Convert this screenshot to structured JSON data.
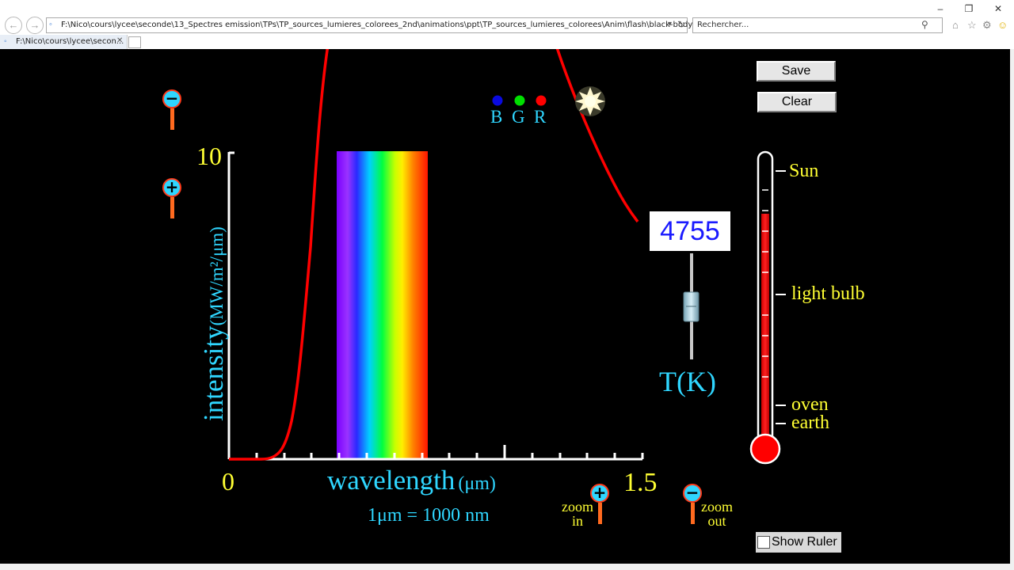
{
  "browser": {
    "address": "F:\\Nico\\cours\\lycee\\seconde\\13_Spectres emission\\TPs\\TP_sources_lumieres_colorees_2nd\\animations\\ppt\\TP_sources_lumieres_colorees\\Anim\\flash\\black-body-radiation.swf",
    "search_placeholder": "Rechercher...",
    "tab_title": "F:\\Nico\\cours\\lycee\\secon..."
  },
  "sim": {
    "save_label": "Save",
    "clear_label": "Clear",
    "show_ruler_label": "Show Ruler",
    "show_ruler_checked": false,
    "temperature_value": "4755",
    "temperature_unit": "T(K)",
    "rgb_labels": {
      "b": "B",
      "g": "G",
      "r": "R"
    },
    "y_axis": {
      "label_main": "intensity",
      "label_unit": "(MW/m²/μm)",
      "max": "10"
    },
    "x_axis": {
      "label_main": "wavelength",
      "label_unit": "(μm)",
      "min": "0",
      "max": "1.5",
      "conversion": "1μm = 1000 nm"
    },
    "zoom_in_label_1": "zoom",
    "zoom_in_label_2": "in",
    "zoom_out_label_1": "zoom",
    "zoom_out_label_2": "out",
    "thermometer_markers": [
      "Sun",
      "light bulb",
      "oven",
      "earth"
    ],
    "colors": {
      "axis": "#ffffff",
      "curve": "#ff0000",
      "label_cyan": "#2fd6ff",
      "label_yellow": "#ffff33",
      "temp_text": "#1a1aff"
    }
  }
}
